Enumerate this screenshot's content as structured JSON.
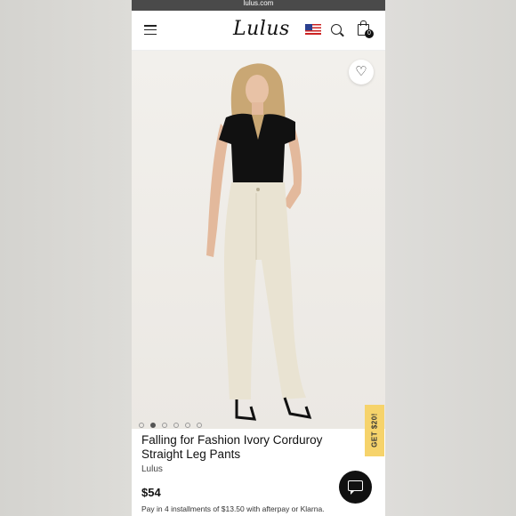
{
  "browser": {
    "url": "lulus.com"
  },
  "header": {
    "logo": "Lulus",
    "bag_count": "0"
  },
  "gallery": {
    "slides": 6,
    "active_slide": 2
  },
  "promo": {
    "label": "GET $20!"
  },
  "product": {
    "title": "Falling for Fashion Ivory Corduroy Straight Leg Pants",
    "brand": "Lulus",
    "price": "$54",
    "installments": "Pay in 4 installments of $13.50 with afterpay or Klarna."
  },
  "colors": {
    "promo": "#f6d36b",
    "pants": "#e9e3d2",
    "top": "#111111"
  }
}
